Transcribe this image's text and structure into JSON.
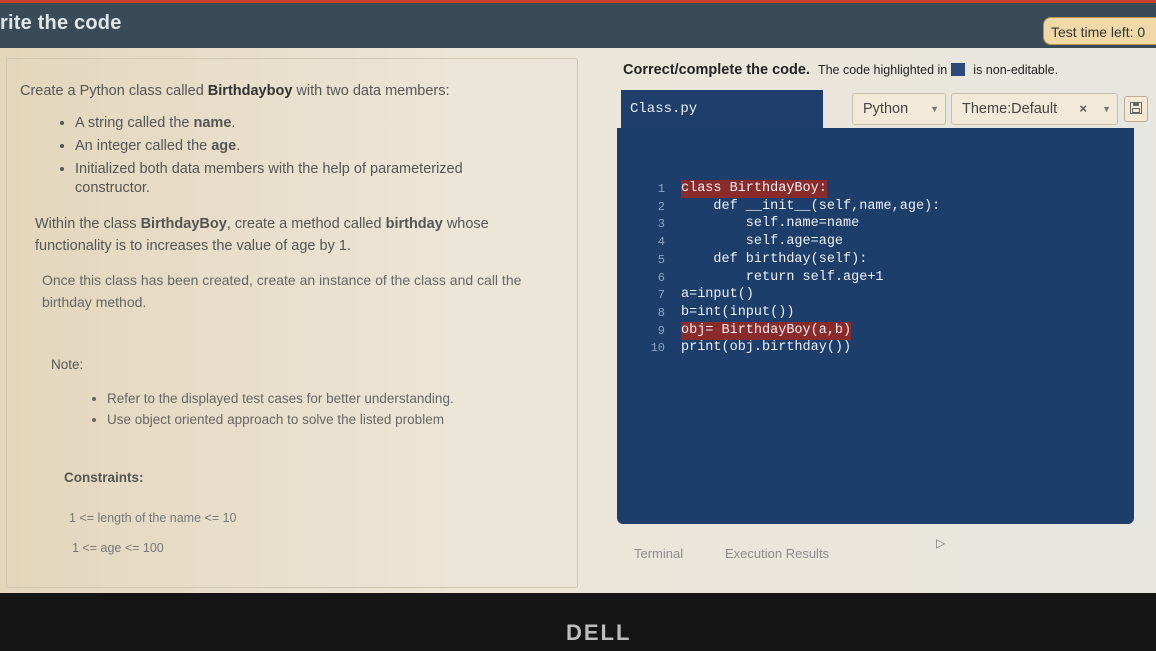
{
  "header": {
    "title": "rite the code",
    "timer_label": "Test time left: 0"
  },
  "problem": {
    "intro_prefix": "Create a Python class called ",
    "intro_class": "Birthdayboy",
    "intro_suffix": " with two data members:",
    "bullets": [
      {
        "prefix": "A string called the ",
        "bold": "name",
        "suffix": "."
      },
      {
        "prefix": "An integer called the ",
        "bold": "age",
        "suffix": "."
      },
      {
        "prefix": "Initialized both data members with the help of parameterized constructor.",
        "bold": "",
        "suffix": ""
      }
    ],
    "method_p1": "Within the class ",
    "method_class": "BirthdayBoy",
    "method_p2": ", create a method called ",
    "method_name": "birthday",
    "method_p3": " whose functionality is to increases the value of age by 1.",
    "instance_text": "Once this class has been created, create an instance of the class and call the birthday method.",
    "note_label": "Note:",
    "notes": [
      "Refer to the displayed test cases for better understanding.",
      "Use object oriented approach to solve the listed problem"
    ],
    "constraints_label": "Constraints:",
    "constraints": [
      "1 <= length of the name <= 10",
      "1 <= age <= 100"
    ]
  },
  "editor": {
    "instruction_bold": "Correct/complete the code.",
    "instruction_pre": "The code highlighted in",
    "instruction_post": "is non-editable.",
    "file_tab": "Class.py",
    "language": "Python",
    "theme": "Theme:Default",
    "lines": [
      {
        "n": "1",
        "text": "class BirthdayBoy:",
        "locked": true
      },
      {
        "n": "2",
        "text": "    def __init__(self,name,age):",
        "locked": false
      },
      {
        "n": "3",
        "text": "        self.name=name",
        "locked": false
      },
      {
        "n": "4",
        "text": "        self.age=age",
        "locked": false
      },
      {
        "n": "5",
        "text": "    def birthday(self):",
        "locked": false
      },
      {
        "n": "6",
        "text": "        return self.age+1",
        "locked": false
      },
      {
        "n": "7",
        "text": "a=input()",
        "locked": false
      },
      {
        "n": "8",
        "text": "b=int(input())",
        "locked": false
      },
      {
        "n": "9",
        "text": "obj= BirthdayBoy(a,b)",
        "locked": true
      },
      {
        "n": "10",
        "text": "print(obj.birthday())",
        "locked": false
      }
    ],
    "tabs": [
      "Terminal",
      "Execution Results"
    ]
  },
  "monitor": {
    "brand": "DELL"
  },
  "colors": {
    "editor_bg": "#1d3d6b",
    "locked_highlight": "#8a2b2b",
    "topbar": "#3a4a56",
    "timer_bg": "#f0d9a6"
  }
}
